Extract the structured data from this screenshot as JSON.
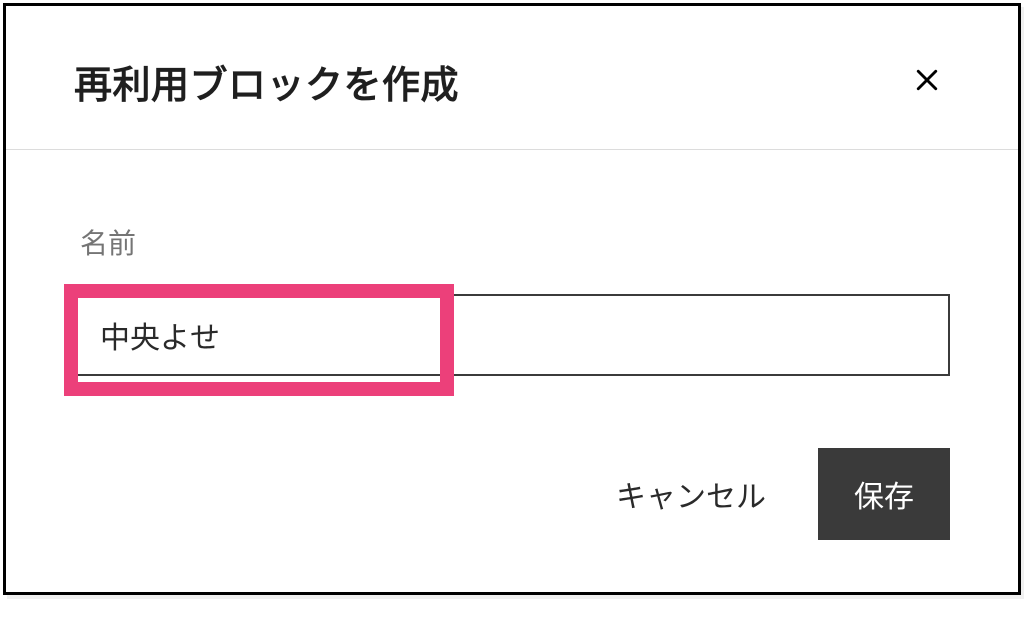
{
  "dialog": {
    "title": "再利用ブロックを作成",
    "body": {
      "name_label": "名前",
      "name_value": "中央よせ"
    },
    "footer": {
      "cancel_label": "キャンセル",
      "save_label": "保存"
    }
  }
}
